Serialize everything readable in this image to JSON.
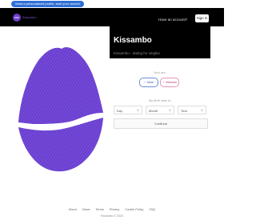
{
  "promo": {
    "text": "Want a personalized profile, start your search!"
  },
  "header": {
    "logo_text": "Kissambo",
    "member_question": "Have an account?",
    "signin_label": "Sign in"
  },
  "hero": {
    "title": "Kissambo",
    "subtitle": "Kissambo - dating for singles"
  },
  "form": {
    "gender_prompt": "Your are...",
    "man_label": "Man",
    "woman_label": "Woman",
    "birthdate_prompt": "My birth date is...",
    "day_placeholder": "Day",
    "month_placeholder": "Month",
    "year_placeholder": "Year",
    "continue_label": "Continue"
  },
  "footer": {
    "links": [
      "About",
      "News",
      "Terms",
      "Privacy",
      "Cookie Policy",
      "FAQ"
    ],
    "copyright": "Kissambo © 2024"
  },
  "colors": {
    "accent": "#6e3fc9",
    "lips": "#6a3fd0",
    "man": "#2f55b0",
    "woman": "#b0306f"
  },
  "icons": {
    "logo": "lips-logo-icon",
    "man": "male-icon",
    "woman": "female-icon",
    "caret": "chevron-down-icon"
  }
}
